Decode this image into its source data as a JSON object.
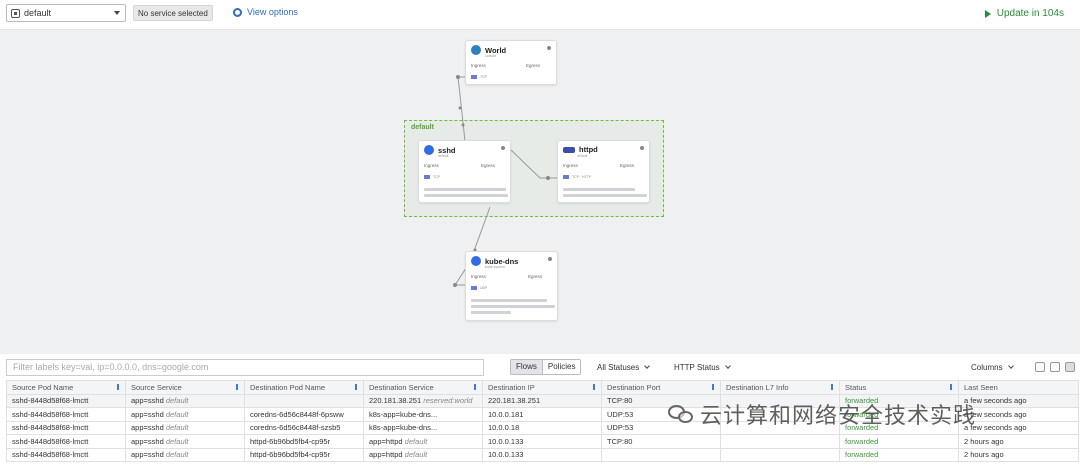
{
  "topbar": {
    "namespace": "default",
    "service_badge": "No service selected",
    "view_options": "View options",
    "update": "Update in 104s"
  },
  "map": {
    "namespace_label": "default",
    "nodes": {
      "world": {
        "title": "World",
        "subtitle": "outside",
        "ingress": "Ingress",
        "egress": "Egress",
        "protocol": "TCP"
      },
      "sshd": {
        "title": "sshd",
        "subtitle": "default",
        "ingress": "Ingress",
        "egress": "Egress",
        "protocol": "TCP"
      },
      "httpd": {
        "title": "httpd",
        "subtitle": "default",
        "ingress": "Ingress",
        "egress": "Egress",
        "protocol": "TCP · HTTP"
      },
      "kubedns": {
        "title": "kube-dns",
        "subtitle": "kube-system",
        "ingress": "Ingress",
        "egress": "Egress",
        "protocol": "UDP"
      }
    }
  },
  "toolbar": {
    "filter_placeholder": "Filter labels key=val, ip=0.0.0.0, dns=google.com",
    "flows": "Flows",
    "policies": "Policies",
    "statuses": "All Statuses",
    "http_status": "HTTP Status",
    "columns": "Columns"
  },
  "table": {
    "headers": [
      "Source Pod Name",
      "Source Service",
      "Destination Pod Name",
      "Destination Service",
      "Destination IP",
      "Destination Port",
      "Destination L7 Info",
      "Status",
      "Last Seen"
    ],
    "rows": [
      {
        "src_pod": "sshd-8448d58f68-lmctt",
        "src_svc": "app=sshd",
        "src_ns": "default",
        "dst_pod": "",
        "dst_svc": "220.181.38.251",
        "dst_ns": "reserved:world",
        "dst_ip": "220.181.38.251",
        "port": "TCP:80",
        "l7": "",
        "status": "forwarded",
        "seen": "a few seconds ago"
      },
      {
        "src_pod": "sshd-8448d58f68-lmctt",
        "src_svc": "app=sshd",
        "src_ns": "default",
        "dst_pod": "coredns-6d56c8448f-6psww",
        "dst_svc": "k8s-app=kube-dns...",
        "dst_ns": "",
        "dst_ip": "10.0.0.181",
        "port": "UDP:53",
        "l7": "",
        "status": "forwarded",
        "seen": "a few seconds ago"
      },
      {
        "src_pod": "sshd-8448d58f68-lmctt",
        "src_svc": "app=sshd",
        "src_ns": "default",
        "dst_pod": "coredns-6d56c8448f-szsb5",
        "dst_svc": "k8s-app=kube-dns...",
        "dst_ns": "",
        "dst_ip": "10.0.0.18",
        "port": "UDP:53",
        "l7": "",
        "status": "forwarded",
        "seen": "a few seconds ago"
      },
      {
        "src_pod": "sshd-8448d58f68-lmctt",
        "src_svc": "app=sshd",
        "src_ns": "default",
        "dst_pod": "httpd-6b96bd5fb4-cp95r",
        "dst_svc": "app=httpd",
        "dst_ns": "default",
        "dst_ip": "10.0.0.133",
        "port": "TCP:80",
        "l7": "",
        "status": "forwarded",
        "seen": "2 hours ago"
      },
      {
        "src_pod": "sshd-8448d58f68-lmctt",
        "src_svc": "app=sshd",
        "src_ns": "default",
        "dst_pod": "httpd-6b96bd5fb4-cp95r",
        "dst_svc": "app=httpd",
        "dst_ns": "default",
        "dst_ip": "10.0.0.133",
        "port": "",
        "l7": "",
        "status": "forwarded",
        "seen": "2 hours ago"
      }
    ]
  },
  "watermark": {
    "text": "云计算和网络安全技术实践"
  }
}
